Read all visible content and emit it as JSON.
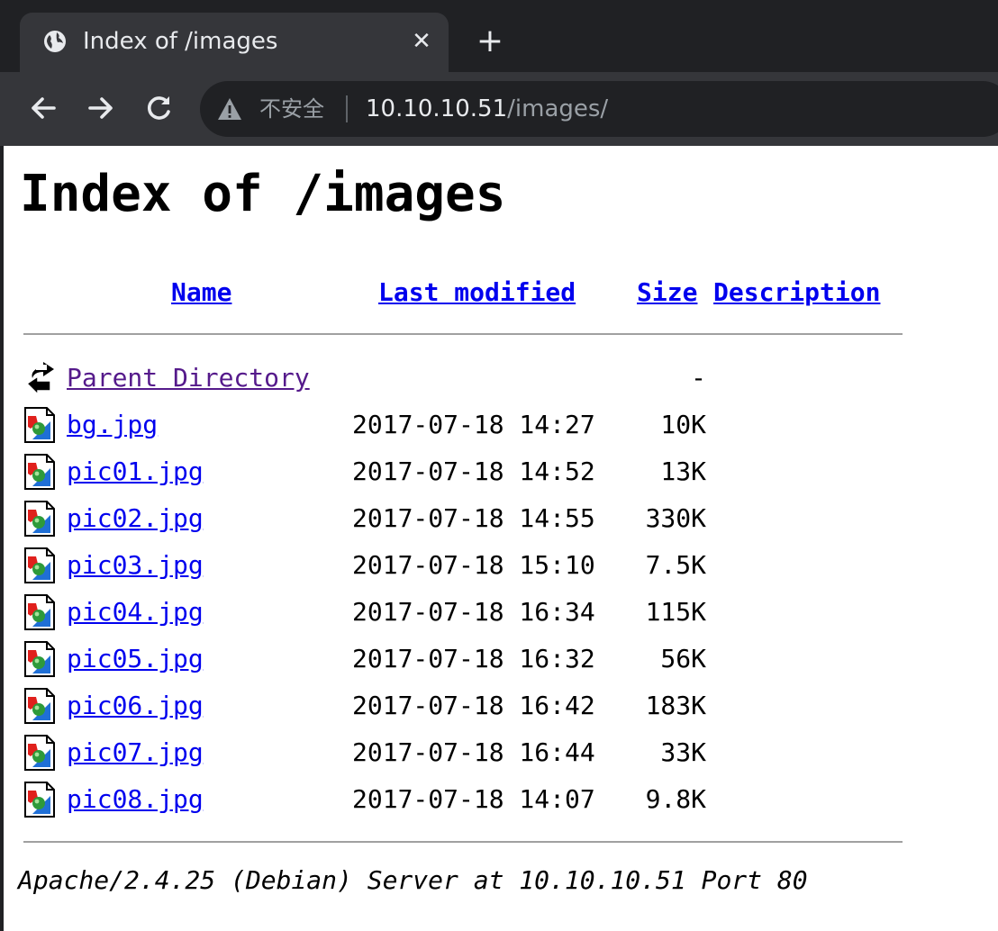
{
  "browser": {
    "tab": {
      "title": "Index of /images",
      "close_glyph": "✕",
      "favicon": "globe-icon"
    },
    "new_tab_glyph": "+",
    "nav": {
      "back": "back-arrow-icon",
      "forward": "forward-arrow-icon",
      "reload": "reload-icon"
    },
    "address_bar": {
      "security_icon": "warning-triangle-icon",
      "security_label": "不安全",
      "host": "10.10.10.51",
      "path": "/images/"
    }
  },
  "page": {
    "title": "Index of /images",
    "columns": {
      "name": "Name",
      "last_modified": "Last modified",
      "size": "Size",
      "description": "Description"
    },
    "parent": {
      "label": "Parent Directory",
      "size": "-",
      "icon": "back-arrow-folder-icon"
    },
    "files": [
      {
        "name": "bg.jpg",
        "modified": "2017-07-18 14:27",
        "size": "10K"
      },
      {
        "name": "pic01.jpg",
        "modified": "2017-07-18 14:52",
        "size": "13K"
      },
      {
        "name": "pic02.jpg",
        "modified": "2017-07-18 14:55",
        "size": "330K"
      },
      {
        "name": "pic03.jpg",
        "modified": "2017-07-18 15:10",
        "size": "7.5K"
      },
      {
        "name": "pic04.jpg",
        "modified": "2017-07-18 16:34",
        "size": "115K"
      },
      {
        "name": "pic05.jpg",
        "modified": "2017-07-18 16:32",
        "size": "56K"
      },
      {
        "name": "pic06.jpg",
        "modified": "2017-07-18 16:42",
        "size": "183K"
      },
      {
        "name": "pic07.jpg",
        "modified": "2017-07-18 16:44",
        "size": "33K"
      },
      {
        "name": "pic08.jpg",
        "modified": "2017-07-18 14:07",
        "size": "9.8K"
      }
    ],
    "file_icon": "image-file-icon",
    "footer": "Apache/2.4.25 (Debian) Server at 10.10.10.51 Port 80"
  },
  "colors": {
    "link": "#0000ee",
    "visited_link": "#551a8b",
    "chrome_dark": "#202124",
    "chrome_toolbar": "#35363a"
  }
}
